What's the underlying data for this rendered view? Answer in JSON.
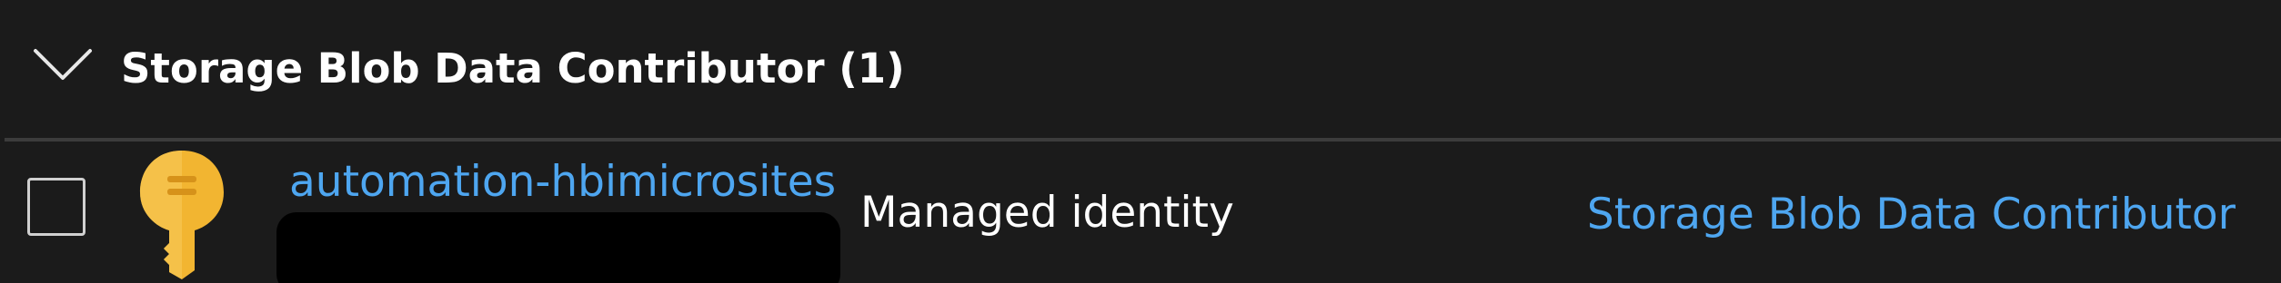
{
  "group": {
    "title": "Storage Blob Data Contributor (1)",
    "chevron_icon": "chevron-down-icon"
  },
  "row": {
    "icon": "managed-identity-key-icon",
    "name": "automation-hbimicrosites",
    "type": "Managed identity",
    "role": "Storage Blob Data Contributor"
  },
  "colors": {
    "background": "#1b1b1b",
    "link": "#4ea6f0",
    "text": "#ffffff",
    "key_icon": "#f2b531"
  }
}
